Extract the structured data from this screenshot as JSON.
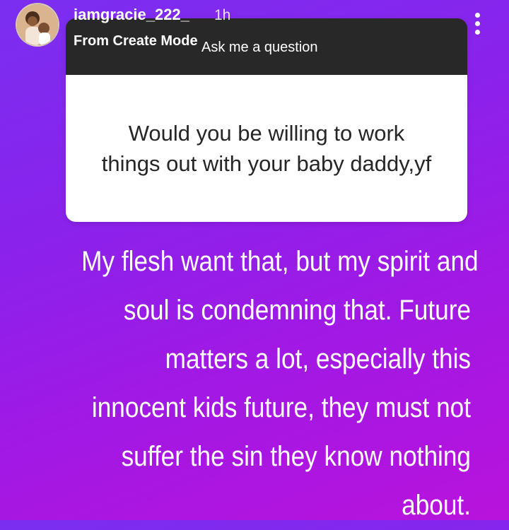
{
  "header": {
    "username": "iamgracie_222_",
    "time": "1h",
    "subtitle": "From Create Mode"
  },
  "card": {
    "prompt": "Ask me a question",
    "question": "Would you be willing to work things out with your baby daddy,yf"
  },
  "answer": {
    "lines": [
      "My flesh want that, but my spirit and",
      "soul is condemning that. Future",
      "matters a lot, especially this",
      "innocent kids future, they must not",
      "suffer the sin they know nothing",
      "about."
    ]
  },
  "icons": {
    "avatar": "profile-avatar",
    "menu": "more-vertical-icon"
  }
}
